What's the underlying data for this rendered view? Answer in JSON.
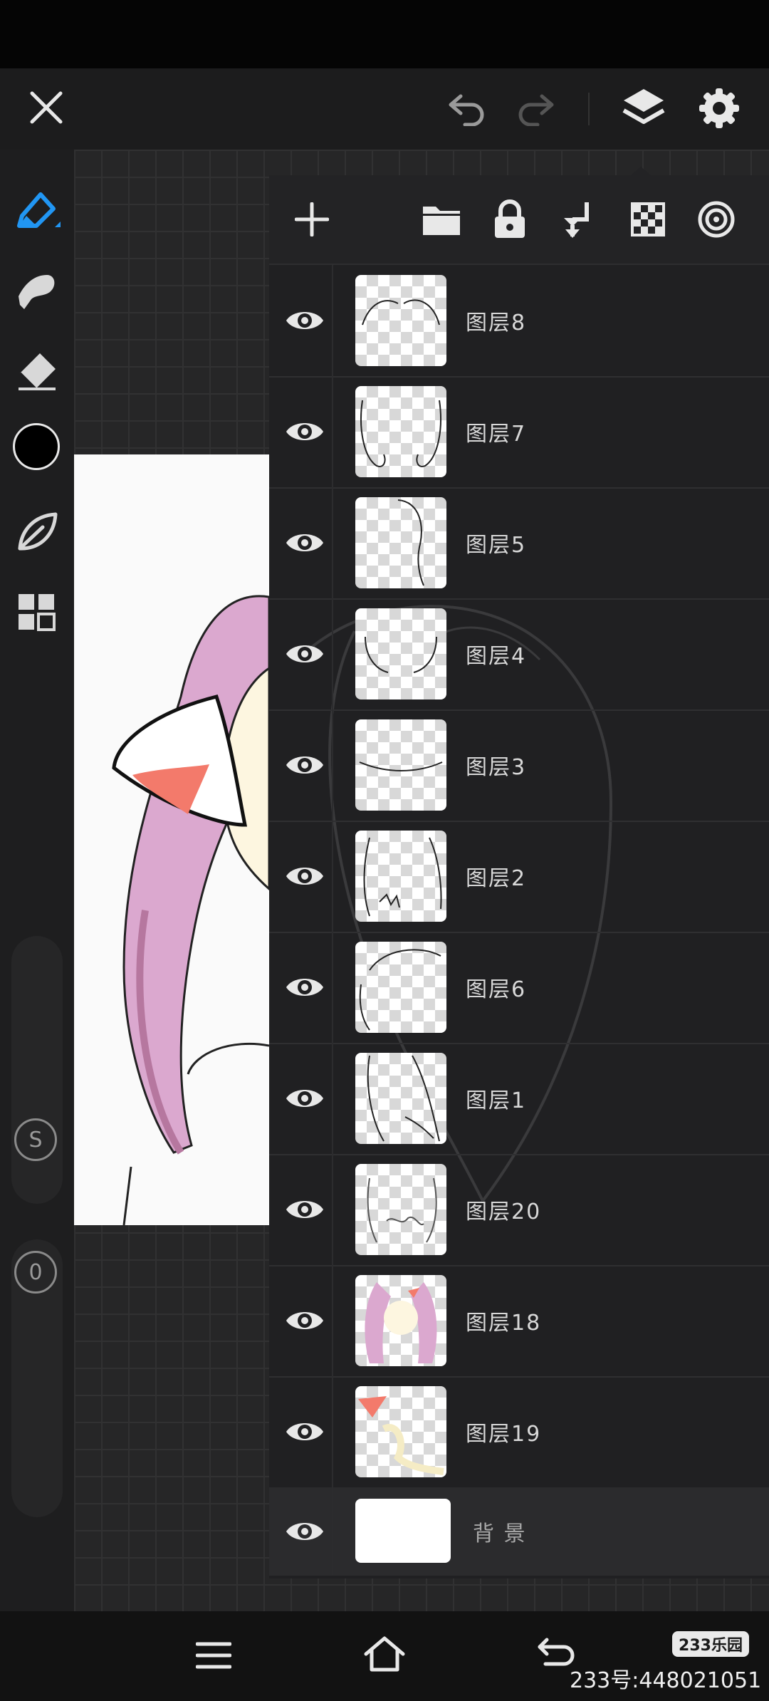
{
  "top_bar": {
    "close_icon": "close-icon",
    "undo_icon": "undo-icon",
    "redo_icon": "redo-icon",
    "layers_icon": "layers-icon",
    "settings_icon": "gear-icon"
  },
  "tools": [
    {
      "name": "pen-tool",
      "icon": "pen-icon",
      "active": true
    },
    {
      "name": "smudge-tool",
      "icon": "smudge-icon"
    },
    {
      "name": "eraser-tool",
      "icon": "eraser-icon"
    },
    {
      "name": "color-swatch",
      "color": "#000000"
    },
    {
      "name": "brush-library",
      "icon": "leaf-icon"
    },
    {
      "name": "grid-menu",
      "icon": "grid-icon"
    }
  ],
  "sliders": {
    "size_label": "S",
    "opacity_label": "0"
  },
  "layers_toolbar": {
    "add_icon": "plus-icon",
    "folder_icon": "folder-icon",
    "lock_icon": "lock-icon",
    "merge_down_icon": "merge-down-icon",
    "alpha_icon": "checkerboard-icon",
    "blend_icon": "concentric-circles-icon"
  },
  "layers": [
    {
      "name": "图层8"
    },
    {
      "name": "图层7"
    },
    {
      "name": "图层5"
    },
    {
      "name": "图层4"
    },
    {
      "name": "图层3"
    },
    {
      "name": "图层2"
    },
    {
      "name": "图层6"
    },
    {
      "name": "图层1"
    },
    {
      "name": "图层20"
    },
    {
      "name": "图层18"
    },
    {
      "name": "图层19"
    }
  ],
  "background_layer": {
    "name": "背 景"
  },
  "bottom_nav": {
    "menu_icon": "menu-icon",
    "home_icon": "home-icon",
    "back_icon": "back-icon"
  },
  "watermark": {
    "logo": "233乐园",
    "id": "233号:448021051"
  },
  "colors": {
    "accent": "#2196f3",
    "hair_pink": "#e3b4d8",
    "ear_inner": "#f37a6b"
  }
}
